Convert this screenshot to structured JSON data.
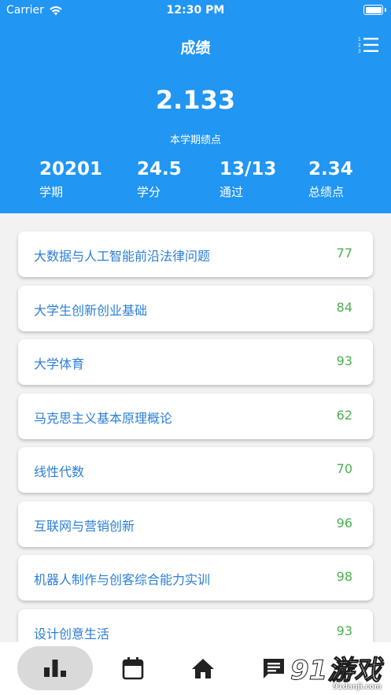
{
  "status": {
    "carrier": "Carrier",
    "time": "12:30 PM"
  },
  "appbar": {
    "title": "成绩"
  },
  "summary": {
    "gpa": "2.133",
    "gpa_label": "本学期绩点",
    "stats": [
      {
        "value": "20201",
        "label": "学期"
      },
      {
        "value": "24.5",
        "label": "学分"
      },
      {
        "value": "13/13",
        "label": "通过"
      },
      {
        "value": "2.34",
        "label": "总绩点"
      }
    ]
  },
  "courses": [
    {
      "name": "大数据与人工智能前沿法律问题",
      "score": "77"
    },
    {
      "name": "大学生创新创业基础",
      "score": "84"
    },
    {
      "name": "大学体育",
      "score": "93"
    },
    {
      "name": "马克思主义基本原理概论",
      "score": "62"
    },
    {
      "name": "线性代数",
      "score": "70"
    },
    {
      "name": "互联网与营销创新",
      "score": "96"
    },
    {
      "name": "机器人制作与创客综合能力实训",
      "score": "98"
    },
    {
      "name": "设计创意生活",
      "score": "93"
    }
  ],
  "nav": [
    "bar-chart-icon",
    "calendar-icon",
    "home-icon",
    "chat-icon",
    "gear-icon"
  ],
  "watermark": {
    "logo": "91游戏",
    "site": "91danji.com"
  },
  "colors": {
    "primary": "#2196f3",
    "course_name": "#2b7fd8",
    "score": "#4caf50"
  }
}
